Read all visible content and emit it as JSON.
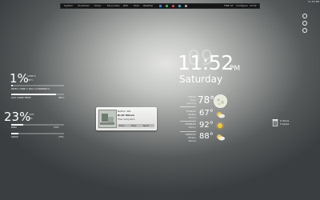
{
  "panel": {
    "items": [
      "System",
      "Shutdown",
      "Music",
      "Favourites",
      "RSS",
      "Todo",
      "Weather",
      "FINE AT",
      "Configure"
    ],
    "clock": "10:52",
    "right_clock": "11:52 PM",
    "swatch_colors": [
      "#3c8be0",
      "#47b36a",
      "#d34646",
      "#36b4d6",
      "#a8a8a8"
    ]
  },
  "cpu": {
    "percent": "1%",
    "lines": [
      "1784 S",
      "78°C"
    ],
    "bar_fill": 0.03,
    "label": "INTEL CORE 2 DUO (CURRENCY)"
  },
  "temp": {
    "label": "CPU CORE TEMP",
    "value": "98°C",
    "bar_fill": 0.85
  },
  "ram": {
    "percent": "23%",
    "lines": [
      "13%",
      "0%"
    ],
    "bar_label": "RAM",
    "bar_value": "23%",
    "bar_fill": 0.23,
    "swap_label": "SWAP",
    "swap_value": "13%",
    "swap_fill": 0.13
  },
  "clock": {
    "ghost": "09",
    "time": "11:52",
    "ampm": "PM",
    "day": "Saturday"
  },
  "weather": [
    {
      "day": "TODAY",
      "lines": [
        "Clear",
        "(sunny)"
      ],
      "temp": "78°",
      "icon": "moon-icon"
    },
    {
      "day": "SUNDAY",
      "lines": [
        "Mostly",
        "Sunny"
      ],
      "temp": "67°",
      "icon": "partly-cloudy-icon"
    },
    {
      "day": "MONDAY",
      "lines": [
        "Sunny"
      ],
      "temp": "92°",
      "icon": "sun-icon"
    },
    {
      "day": "TUESDAY",
      "lines": [
        "Mostly",
        "Sunny"
      ],
      "temp": "88°",
      "icon": "partly-cloudy-icon"
    }
  ],
  "music": {
    "line1": "Nothin' We",
    "line2": "Brett Wilson",
    "line3": "The rocky bird",
    "prev": "Prev",
    "play": "Play",
    "next": "Next"
  },
  "trash": {
    "line1": "0 items",
    "line2": "0 bytes"
  }
}
